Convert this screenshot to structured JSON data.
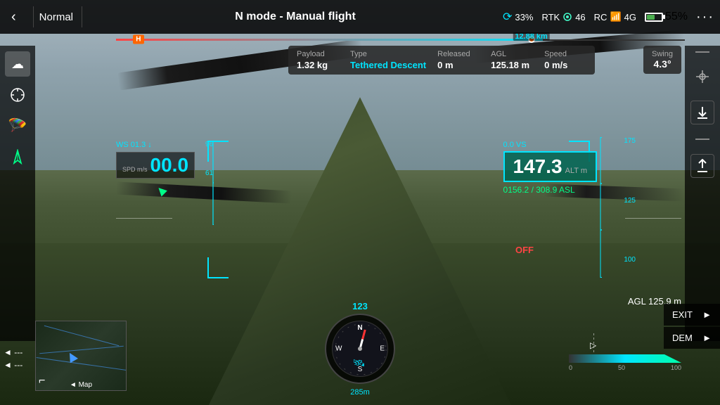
{
  "topbar": {
    "back_label": "‹",
    "mode_label": "Normal",
    "flight_mode": "N mode - Manual flight",
    "battery_pct": "55%",
    "rtk_label": "RTK",
    "rtk_value": "46",
    "rc_label": "RC",
    "rc_signal": "4G",
    "gps_pct": "33%",
    "more_label": "···"
  },
  "distance_bar": {
    "distance": "12.88 km",
    "h_marker": "H"
  },
  "info_panel": {
    "payload_label": "Payload",
    "payload_value": "1.32 kg",
    "type_label": "Type",
    "type_value": "Tethered Descent",
    "released_label": "Released",
    "released_value": "0 m",
    "agl_label": "AGL",
    "agl_value": "125.18 m",
    "speed_label": "Speed",
    "speed_value": "0 m/s"
  },
  "swing_panel": {
    "label": "Swing",
    "value": "4.3°"
  },
  "hud": {
    "wind_label": "WS 01.3",
    "wind_dir": "↓",
    "speed_label": "SPD\nm/s",
    "speed_value": "00.0",
    "alt_small": "0.0 VS",
    "alt_value": "147.3",
    "alt_unit": "ALT\nm",
    "off_label": "OFF",
    "asl_value": "0156.2 / 308.9 ASL",
    "scale_175": "175",
    "scale_125": "125",
    "scale_100": "100",
    "scale_96": "96",
    "scale_61": "61"
  },
  "compass": {
    "heading": "123",
    "n_label": "N",
    "s_label": "S",
    "e_label": "E",
    "w_label": "W",
    "dist_label": "285m"
  },
  "map": {
    "label": "◄ Map",
    "corner_icon": "⌐"
  },
  "bottom_controls": {
    "left_arrows": "◄ ---",
    "left_arrows2": "◄ ---"
  },
  "agl_display": {
    "label": "AGL",
    "value": "125.9 m"
  },
  "exit_dem": {
    "exit_label": "EXIT",
    "exit_arrow": "►",
    "dem_label": "DEM",
    "dem_arrow": "►"
  },
  "alt_scale": {
    "labels": [
      "0",
      "50",
      "100"
    ]
  }
}
